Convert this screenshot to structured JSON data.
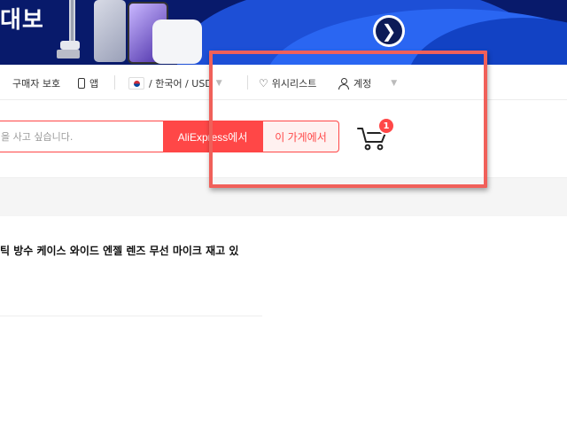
{
  "banner": {
    "title": "대보",
    "next_icon": "chevron-right-icon"
  },
  "topbar": {
    "buyer_protection": "구매자 보호",
    "app": "앱",
    "locale": "/ 한국어 /  USD",
    "wishlist": "위시리스트",
    "account": "계정"
  },
  "search": {
    "placeholder": "을 사고 싶습니다.",
    "aliexpress_button": "AliExpress에서",
    "store_button": "이 가게에서"
  },
  "cart": {
    "count": "1",
    "icon": "cart-icon"
  },
  "product": {
    "title": "틱 방수 케이스 와이드 엔젤 렌즈 무선 마이크 재고 있"
  },
  "colors": {
    "accent": "#ff4747",
    "banner_bg": "#081a6b",
    "highlight": "#f0605a"
  }
}
